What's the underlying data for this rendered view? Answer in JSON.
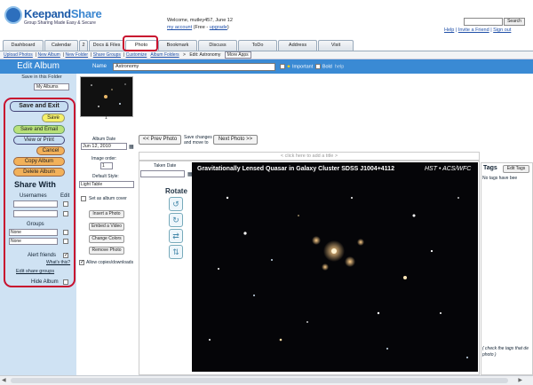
{
  "brand": {
    "name_a": "Keepand",
    "name_b": "Share",
    "tagline": "Group Sharing Made Easy & Secure"
  },
  "header": {
    "welcome": "Welcome, mutley457,",
    "date": "June 12",
    "my_account": "my account",
    "plan": "(Free - ",
    "upgrade": "upgrade",
    "plan_end": ")",
    "search_label": "Search",
    "search_placeholder": "",
    "help": "Help",
    "invite": "Invite a Friend",
    "signout": "Sign out"
  },
  "tabs": [
    {
      "label": "Dashboard",
      "w": 46
    },
    {
      "label": "Calendar",
      "w": 38
    },
    {
      "label": "2",
      "w": 10
    },
    {
      "label": "Docs & Files",
      "w": 40
    },
    {
      "label": "Photo",
      "w": 36
    },
    {
      "label": "Bookmark",
      "w": 44
    },
    {
      "label": "Discuss",
      "w": 44
    },
    {
      "label": "ToDo",
      "w": 44
    },
    {
      "label": "Address",
      "w": 44
    },
    {
      "label": "Visit",
      "w": 40
    }
  ],
  "subnav": {
    "items": [
      "Upload Photos",
      "New Album",
      "New Folder",
      "Share Groups",
      "Customize"
    ],
    "crumb_folders": "Album Folders",
    "crumb_sep": ">",
    "crumb_current": "Edit: Astronomy",
    "more_apps": "More Apps"
  },
  "edit": {
    "title": "Edit Album",
    "name_label": "Name",
    "name_value": "Astronomy",
    "important": "Important",
    "bold": "Bold",
    "help": "help",
    "save_in_folder": "Save in this Folder",
    "folder_value": "My Albums"
  },
  "actions": {
    "save_exit": "Save and Exit",
    "save": "Save",
    "save_email": "Save and Email",
    "view_print": "View or Print",
    "cancel": "Cancel",
    "copy": "Copy Album",
    "delete": "Delete Album"
  },
  "share": {
    "title": "Share With",
    "usernames": "Usernames",
    "edit": "Edit",
    "groups": "Groups",
    "group1": "None",
    "group2": "None",
    "alert": "Alert friends",
    "whats_this": "What's this?",
    "edit_groups": "Edit share groups",
    "hide": "Hide Album"
  },
  "thumb": {
    "number": "1"
  },
  "photo_meta": {
    "album_date_label": "Album Date",
    "album_date": "Jun 12, 2010",
    "image_order_label": "Image order:",
    "image_order": "1",
    "default_style_label": "Default Style:",
    "default_style": "Light Table",
    "album_cover": "Set as album cover",
    "insert_photo": "Insert a Photo",
    "embed_video": "Embed a Video",
    "change_colors": "Change Colors",
    "remove_photo": "Remove Photo",
    "allow_copies": "Allow copies/downloads"
  },
  "photo_nav": {
    "prev": "<< Prev Photo",
    "save_note_1": "Save changes",
    "save_note_2": "and move to",
    "next": "Next Photo >>",
    "caption_placeholder": "< click here to add a title >",
    "taken_date": "Taken Date",
    "rotate": "Rotate"
  },
  "photo": {
    "title": "Gravitationally Lensed Quasar in Galaxy Cluster SDSS J1004+4112",
    "credit": "HST • ACS/WFC"
  },
  "tags": {
    "title": "Tags",
    "edit_tags": "Edit Tags",
    "empty": "No tags have bee",
    "footer_1": "( check the tags that de",
    "footer_2": "photo )"
  }
}
